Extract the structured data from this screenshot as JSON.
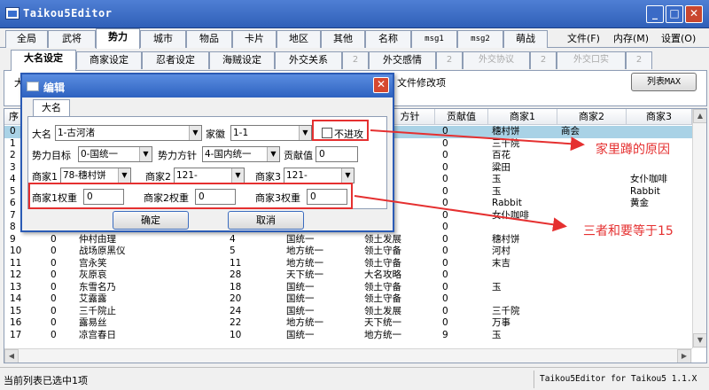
{
  "window": {
    "title": "Taikou5Editor",
    "buttons": [
      "_",
      "□",
      "✕"
    ]
  },
  "main_tabs": [
    "全局",
    "武将",
    "势力",
    "城市",
    "物品",
    "卡片",
    "地区",
    "其他",
    "名称",
    "msg1",
    "msg2",
    "萌战"
  ],
  "menu": {
    "file": "文件(F)",
    "memory": "内存(M)",
    "settings": "设置(O)"
  },
  "sub_tabs": [
    "大名设定",
    "商家设定",
    "忍者设定",
    "海贼设定",
    "外交关系",
    "2",
    "外交感情",
    "2",
    "外交协议",
    "2",
    "外交口实",
    "2"
  ],
  "panel": {
    "prefix": "大",
    "file_option": "文件修改项",
    "list_max_button": "列表MAX"
  },
  "table": {
    "columns": [
      "序",
      "",
      "",
      "",
      "",
      "方针",
      "贡献值",
      "商家1",
      "商家2",
      "商家3"
    ],
    "rows": [
      [
        "0",
        "",
        "",
        "",
        "",
        "一",
        "0",
        "穗村饼",
        "商会",
        ""
      ],
      [
        "1",
        "",
        "",
        "",
        "",
        "备",
        "0",
        "三千院",
        "",
        ""
      ],
      [
        "2",
        "",
        "",
        "",
        "",
        "备",
        "0",
        "百花",
        "",
        ""
      ],
      [
        "3",
        "",
        "",
        "",
        "",
        "一",
        "0",
        "粱田",
        "",
        ""
      ],
      [
        "4",
        "",
        "",
        "",
        "",
        "备",
        "0",
        "玉",
        "",
        "女仆咖啡"
      ],
      [
        "5",
        "",
        "",
        "",
        "",
        "展",
        "0",
        "玉",
        "",
        "Rabbit"
      ],
      [
        "6",
        "",
        "",
        "",
        "",
        "备",
        "0",
        "Rabbit",
        "",
        "黄金"
      ],
      [
        "7",
        "",
        "",
        "",
        "",
        "一",
        "0",
        "女仆咖啡",
        "",
        ""
      ],
      [
        "8",
        "",
        "",
        "",
        "",
        "一",
        "0",
        "",
        "",
        ""
      ],
      [
        "9",
        "0",
        "仲村由理",
        "4",
        "国统一",
        "领土发展",
        "0",
        "穗村饼",
        "",
        ""
      ],
      [
        "10",
        "0",
        "战场原黑仪",
        "5",
        "地方统一",
        "领土守备",
        "0",
        "河村",
        "",
        ""
      ],
      [
        "11",
        "0",
        "宫永笑",
        "11",
        "地方统一",
        "领土守备",
        "0",
        "末吉",
        "",
        ""
      ],
      [
        "12",
        "0",
        "灰原哀",
        "28",
        "天下统一",
        "大名攻略",
        "0",
        "",
        "",
        ""
      ],
      [
        "13",
        "0",
        "东雪名乃",
        "18",
        "国统一",
        "领土守备",
        "0",
        "玉",
        "",
        ""
      ],
      [
        "14",
        "0",
        "艾露露",
        "20",
        "国统一",
        "领土守备",
        "0",
        "",
        "",
        ""
      ],
      [
        "15",
        "0",
        "三千院止",
        "24",
        "国统一",
        "领土发展",
        "0",
        "三千院",
        "",
        ""
      ],
      [
        "16",
        "0",
        "露易丝",
        "22",
        "地方统一",
        "天下统一",
        "0",
        "万事",
        "",
        ""
      ],
      [
        "17",
        "0",
        "凉宫春日",
        "10",
        "国统一",
        "地方统一",
        "9",
        "玉",
        "",
        ""
      ]
    ]
  },
  "status": {
    "left": "当前列表已选中1项",
    "right": "Taikou5Editor for Taikou5 1.1.X"
  },
  "dialog": {
    "title": "编辑",
    "tab": "大名",
    "fields": {
      "daimyo_label": "大名",
      "daimyo_value": "1-古河渚",
      "crest_label": "家徽",
      "crest_value": "1-1",
      "no_attack_label": "不进攻",
      "goal_label": "势力目标",
      "goal_value": "0-国统一",
      "policy_label": "势力方针",
      "policy_value": "4-国内统一",
      "contrib_label": "贡献值",
      "contrib_value": "0",
      "m1_label": "商家1",
      "m1_value": "78-穗村饼",
      "m2_label": "商家2",
      "m2_value": "121-",
      "m3_label": "商家3",
      "m3_value": "121-",
      "w1_label": "商家1权重",
      "w1_value": "0",
      "w2_label": "商家2权重",
      "w2_value": "0",
      "w3_label": "商家3权重",
      "w3_value": "0"
    },
    "ok": "确定",
    "cancel": "取消"
  },
  "annotations": {
    "a1": "家里蹲的原因",
    "a2": "三者和要等于15"
  },
  "colors": {
    "title_bar": "#2f5fb8",
    "selection": "#a9d2e6",
    "annotation": "#e53030"
  }
}
